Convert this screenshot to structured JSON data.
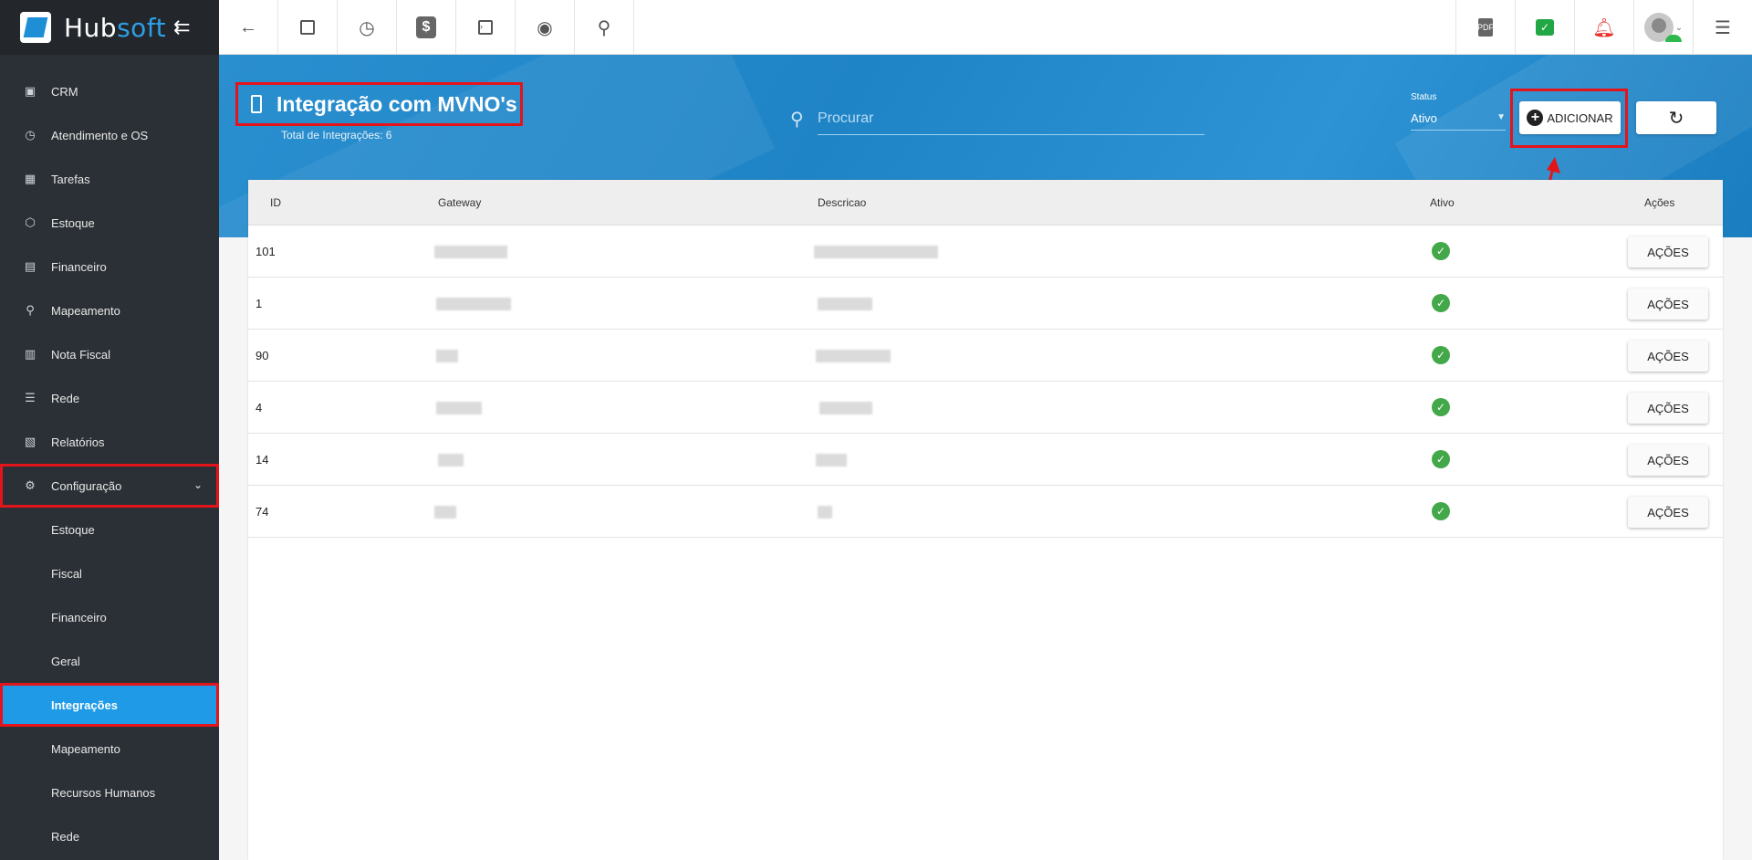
{
  "brand": {
    "name_part1": "Hub",
    "name_part2": "soft",
    "collapse_icon": "arrow-left-icon"
  },
  "sidebar": {
    "items": [
      {
        "label": "CRM",
        "icon": "crm-icon"
      },
      {
        "label": "Atendimento e OS",
        "icon": "calendar-clock-icon"
      },
      {
        "label": "Tarefas",
        "icon": "tasks-icon"
      },
      {
        "label": "Estoque",
        "icon": "box-icon"
      },
      {
        "label": "Financeiro",
        "icon": "money-icon"
      },
      {
        "label": "Mapeamento",
        "icon": "map-pin-icon"
      },
      {
        "label": "Nota Fiscal",
        "icon": "invoice-icon"
      },
      {
        "label": "Rede",
        "icon": "server-icon"
      },
      {
        "label": "Relatórios",
        "icon": "report-icon"
      },
      {
        "label": "Configuração",
        "icon": "gear-icon",
        "expanded": true
      }
    ],
    "subitems": [
      {
        "label": "Estoque"
      },
      {
        "label": "Fiscal"
      },
      {
        "label": "Financeiro"
      },
      {
        "label": "Geral"
      },
      {
        "label": "Integrações",
        "active": true
      },
      {
        "label": "Mapeamento"
      },
      {
        "label": "Recursos Humanos"
      },
      {
        "label": "Rede"
      }
    ]
  },
  "topbar": {
    "left_icons": [
      "back-arrow-icon",
      "contact-card-icon",
      "calendar-clock-icon",
      "dollar-icon",
      "terminal-icon",
      "eye-icon",
      "search-icon"
    ],
    "right_icons": [
      "pdf-icon",
      "chat-check-icon",
      "bell-alarm-icon",
      "user-avatar-icon",
      "menu-list-icon"
    ]
  },
  "header": {
    "title": "Integração com MVNO's",
    "subtitle": "Total de Integrações: 6",
    "search_placeholder": "Procurar",
    "status_label": "Status",
    "status_value": "Ativo",
    "add_label": "ADICIONAR"
  },
  "table": {
    "columns": {
      "id": "ID",
      "gateway": "Gateway",
      "descricao": "Descricao",
      "ativo": "Ativo",
      "acoes": "Ações"
    },
    "rows": [
      {
        "id": "101",
        "ativo": true,
        "action": "AÇÕES"
      },
      {
        "id": "1",
        "ativo": true,
        "action": "AÇÕES"
      },
      {
        "id": "90",
        "ativo": true,
        "action": "AÇÕES"
      },
      {
        "id": "4",
        "ativo": true,
        "action": "AÇÕES"
      },
      {
        "id": "14",
        "ativo": true,
        "action": "AÇÕES"
      },
      {
        "id": "74",
        "ativo": true,
        "action": "AÇÕES"
      }
    ]
  },
  "colors": {
    "sidebar_bg": "#2b3036",
    "accent": "#1e9ae6",
    "highlight": "#e4141b",
    "success": "#43a84a",
    "banner": "#2a8fcf"
  }
}
